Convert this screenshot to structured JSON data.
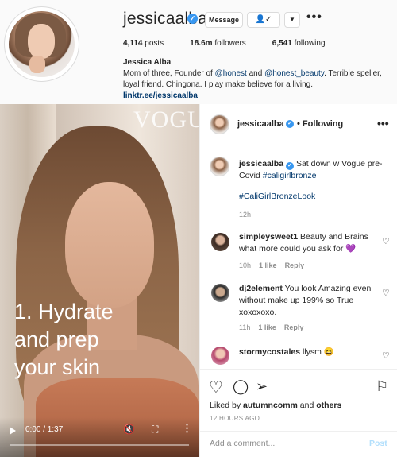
{
  "profile": {
    "username": "jessicaalba",
    "verified_glyph": "✓",
    "message_label": "Message",
    "follow_glyph": "👤✓",
    "dropdown_glyph": "▼",
    "more_glyph": "•••",
    "stats": {
      "posts_count": "4,114",
      "posts_label": "posts",
      "followers_count": "18.6m",
      "followers_label": "followers",
      "following_count": "6,541",
      "following_label": "following"
    },
    "full_name": "Jessica Alba",
    "bio_part1": "Mom of three, Founder of ",
    "bio_mention1": "@honest",
    "bio_part2": " and ",
    "bio_mention2": "@honest_beauty",
    "bio_part3": ". Terrible speller, loyal friend. Chingona. I play make believe for a living.",
    "link": "linktr.ee/jessicaalba"
  },
  "video": {
    "watermark": "VOGUE",
    "caption_line1": "1. Hydrate",
    "caption_line2": "and prep",
    "caption_line3": "your skin",
    "time": "0:00 / 1:37",
    "progress": 0,
    "mute_glyph": "🔇",
    "fullscreen_glyph": "⛶",
    "more_glyph": "⋮"
  },
  "post": {
    "header_user": "jessicaalba",
    "verified_glyph": "✓",
    "following_label": "• Following",
    "more_glyph": "•••",
    "caption_user": "jessicaalba",
    "caption_text": " Sat down w Vogue pre-Covid ",
    "caption_tag": "#caligirlbronze",
    "caption_tag2": "#CaliGirlBronzeLook",
    "caption_time": "12h",
    "comments": [
      {
        "user": "simpleysweet1",
        "text": " Beauty and Brains what more could you ask for 💜",
        "time": "10h",
        "likes": "1 like",
        "reply": "Reply"
      },
      {
        "user": "dj2element",
        "text": " You look Amazing even without make up 199% so True xoxoxoxo.",
        "time": "11h",
        "likes": "1 like",
        "reply": "Reply"
      },
      {
        "user": "stormycostales",
        "text": " llysm 😆"
      }
    ],
    "heart_glyph": "♡",
    "liked_prefix": "Liked by ",
    "liked_user": "autumncomm",
    "liked_and": " and ",
    "liked_others": "others",
    "posted_time": "12 HOURS AGO",
    "comment_placeholder": "Add a comment...",
    "post_label": "Post",
    "icons": {
      "like": "♡",
      "comment": "◯",
      "share": "➢",
      "save": "⚐"
    }
  }
}
